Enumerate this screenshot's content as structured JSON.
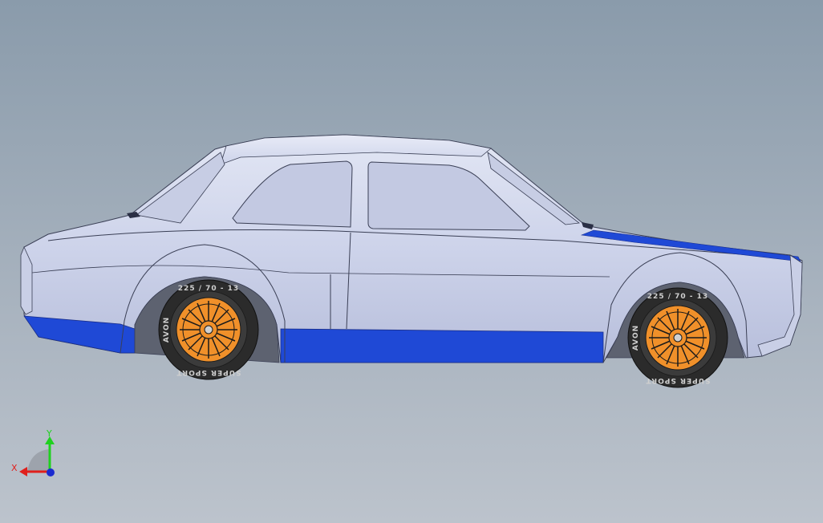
{
  "viewport": {
    "background_top": "#8a9bab",
    "background_bottom": "#bcc3cc"
  },
  "model": {
    "body_color": "#d4d9ec",
    "body_shade": "#b9c0dd",
    "window_color": "#c3c9e2",
    "accent_color": "#1f49d6",
    "rim_color": "#f0902a",
    "tire_color": "#2b2b2b"
  },
  "tire": {
    "size_text": "225 / 70 - 13",
    "brand_text": "AVON",
    "model_text": "SUPER SPORT"
  },
  "triad": {
    "x_label": "X",
    "y_label": "Y",
    "x_color": "#e0201c",
    "y_color": "#1fd11f",
    "z_color": "#1b2bd0"
  }
}
